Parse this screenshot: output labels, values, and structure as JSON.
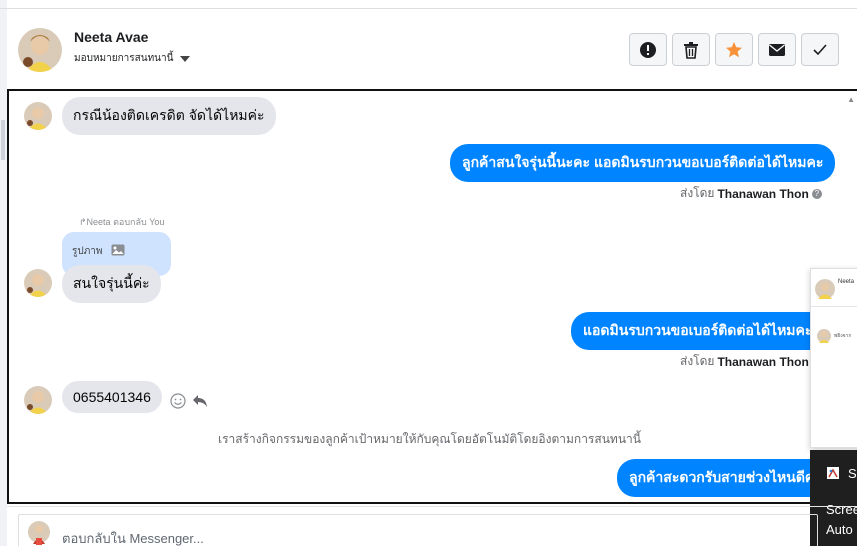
{
  "header": {
    "name": "Neeta Avae",
    "assign_label": "มอบหมายการสนทนานี้"
  },
  "actions": [
    {
      "name": "spam",
      "icon": "exclamation-icon"
    },
    {
      "name": "delete",
      "icon": "trash-icon"
    },
    {
      "name": "star",
      "icon": "star-icon",
      "color": "#f7923b"
    },
    {
      "name": "unread",
      "icon": "envelope-icon"
    },
    {
      "name": "done",
      "icon": "check-icon"
    }
  ],
  "messages": {
    "m1": "กรณีน้องติดเครดิต จัดได้ไหมค่ะ",
    "m2": "ลูกค้าสนใจรุ่นนี้นะคะ  แอดมินรบกวนขอเบอร์ติดต่อได้ไหมคะ",
    "sent_by_label": "ส่งโดย",
    "sent_by_name": "Thanawan Thon",
    "reply_note": "Neeta ตอบกลับ You",
    "reply_quote": "รูปภาพ",
    "m3": "สนใจรุ่นนี้ค่ะ",
    "m4": "แอดมินรบกวนขอเบอร์ติดต่อได้ไหมคะ+",
    "m5": "0655401346",
    "system_note": "เราสร้างกิจกรรมของลูกค้าเป้าหมายให้กับคุณโดยอัตโนมัติโดยอิงตามการสนทนานี้",
    "m6": "ลูกค้าสะดวกรับสายช่วงไหนดีคะ"
  },
  "popup": {
    "name": "Neeta",
    "snippet": "พยิงจาก"
  },
  "dark_box": {
    "letter": "S",
    "line1": "Scree",
    "line2": "Auto"
  },
  "composer": {
    "placeholder": "ตอบกลับใน Messenger..."
  },
  "colors": {
    "accent": "#0084ff",
    "star": "#f7923b"
  }
}
